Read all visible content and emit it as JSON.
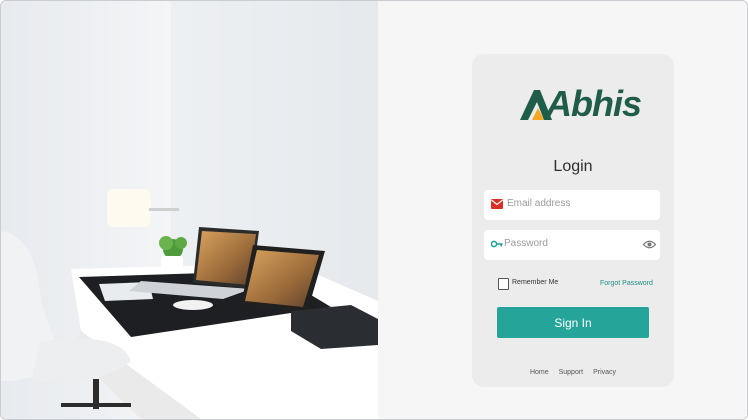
{
  "brand": {
    "logo_text": "Abhis",
    "colors": {
      "primary": "#1f5c4a",
      "accent": "#f5a623",
      "button": "#25a59a"
    }
  },
  "login": {
    "title": "Login",
    "email_placeholder": "Email address",
    "password_placeholder": "Password",
    "remember_label": "Remember Me",
    "forgot_label": "Forgot Password",
    "submit_label": "Sign In",
    "icons": [
      "mail-icon",
      "key-icon",
      "eye-icon"
    ]
  },
  "footer": {
    "links": [
      "Home",
      "Support",
      "Privacy"
    ]
  }
}
